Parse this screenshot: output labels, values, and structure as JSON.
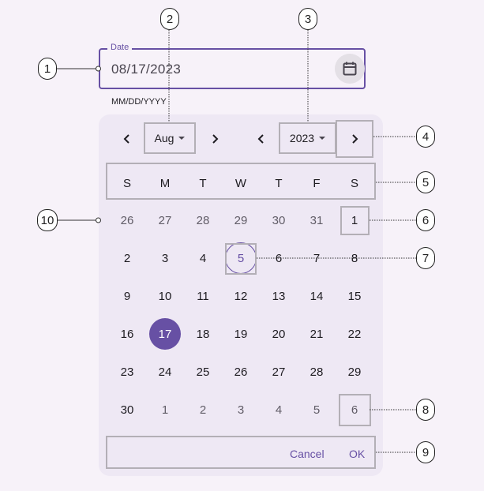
{
  "date_input": {
    "label": "Date",
    "value": "08/17/2023",
    "format_hint": "MM/DD/YYYY",
    "calendar_icon": "calendar-icon"
  },
  "picker": {
    "month": "Aug",
    "year": "2023",
    "prev_icon": "chevron-left-icon",
    "next_icon": "chevron-right-icon",
    "weekdays": [
      "S",
      "M",
      "T",
      "W",
      "T",
      "F",
      "S"
    ],
    "weeks": [
      [
        "26",
        "27",
        "28",
        "29",
        "30",
        "31",
        "1"
      ],
      [
        "2",
        "3",
        "4",
        "5",
        "6",
        "7",
        "8"
      ],
      [
        "9",
        "10",
        "11",
        "12",
        "13",
        "14",
        "15"
      ],
      [
        "16",
        "17",
        "18",
        "19",
        "20",
        "21",
        "22"
      ],
      [
        "23",
        "24",
        "25",
        "26",
        "27",
        "28",
        "29"
      ],
      [
        "30",
        "1",
        "2",
        "3",
        "4",
        "5",
        "6"
      ]
    ],
    "selected_day": "17",
    "today": "5",
    "actions": {
      "cancel": "Cancel",
      "ok": "OK"
    }
  },
  "callouts": [
    "1",
    "2",
    "3",
    "4",
    "5",
    "6",
    "7",
    "8",
    "9",
    "10"
  ],
  "colors": {
    "primary": "#6750a4",
    "panel": "#eee8f4",
    "background": "#f7f2f9"
  }
}
